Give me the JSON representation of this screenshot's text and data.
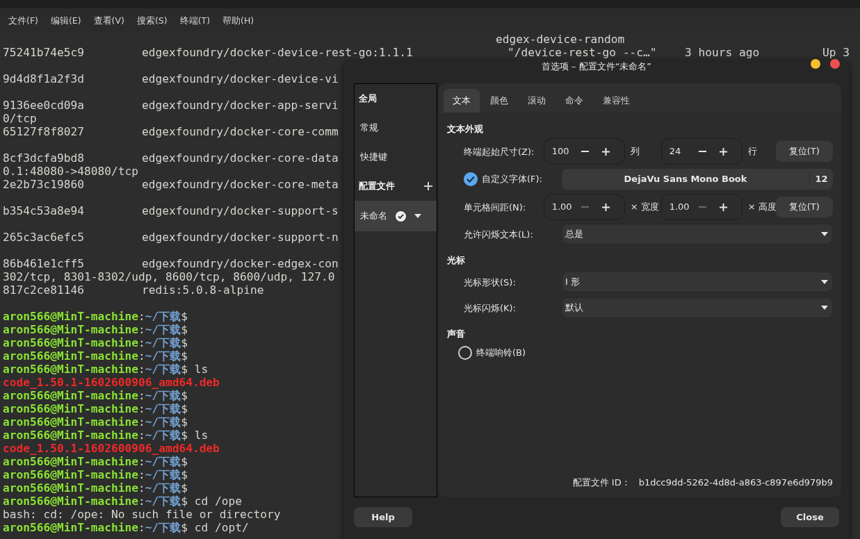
{
  "menu": [
    "文件(F)",
    "编辑(E)",
    "查看(V)",
    "搜索(S)",
    "终端(T)",
    "帮助(H)"
  ],
  "terminal": [
    {
      "kind": "name_header",
      "text": "edgex-device-random"
    },
    {
      "kind": "docker",
      "cells": [
        "75241b74e5c9",
        "edgexfoundry/docker-device-rest-go:1.1.1",
        "\"/device-rest-go --c…\"",
        "3 hours ago",
        "Up 3"
      ]
    },
    {
      "kind": "blank"
    },
    {
      "kind": "docker",
      "cells": [
        "9d4d8f1a2f3d",
        "edgexfoundry/docker-device-vi"
      ]
    },
    {
      "kind": "blank"
    },
    {
      "kind": "docker",
      "cells": [
        "9136ee0cd09a",
        "edgexfoundry/docker-app-servi"
      ]
    },
    {
      "kind": "plain",
      "text": "0/tcp"
    },
    {
      "kind": "docker",
      "cells": [
        "65127f8f8027",
        "edgexfoundry/docker-core-comm"
      ]
    },
    {
      "kind": "blank"
    },
    {
      "kind": "docker",
      "cells": [
        "8cf3dcfa9bd8",
        "edgexfoundry/docker-core-data"
      ]
    },
    {
      "kind": "plain",
      "text": "0.1:48080->48080/tcp"
    },
    {
      "kind": "docker",
      "cells": [
        "2e2b73c19860",
        "edgexfoundry/docker-core-meta"
      ]
    },
    {
      "kind": "blank"
    },
    {
      "kind": "docker",
      "cells": [
        "b354c53a8e94",
        "edgexfoundry/docker-support-s"
      ]
    },
    {
      "kind": "blank"
    },
    {
      "kind": "docker",
      "cells": [
        "265c3ac6efc5",
        "edgexfoundry/docker-support-n"
      ]
    },
    {
      "kind": "blank"
    },
    {
      "kind": "docker",
      "cells": [
        "86b461e1cff5",
        "edgexfoundry/docker-edgex-con"
      ]
    },
    {
      "kind": "plain",
      "text": "302/tcp, 8301-8302/udp, 8600/tcp, 8600/udp, 127.0"
    },
    {
      "kind": "docker",
      "cells": [
        "817c2ce81146",
        "redis:5.0.8-alpine"
      ]
    },
    {
      "kind": "blank"
    },
    {
      "kind": "prompt",
      "user": "aron566@MinT-machine",
      "separator": ":",
      "path": "~/下载",
      "sign": "$"
    },
    {
      "kind": "prompt",
      "user": "aron566@MinT-machine",
      "separator": ":",
      "path": "~/下载",
      "sign": "$"
    },
    {
      "kind": "prompt",
      "user": "aron566@MinT-machine",
      "separator": ":",
      "path": "~/下载",
      "sign": "$"
    },
    {
      "kind": "prompt",
      "user": "aron566@MinT-machine",
      "separator": ":",
      "path": "~/下载",
      "sign": "$"
    },
    {
      "kind": "prompt",
      "user": "aron566@MinT-machine",
      "separator": ":",
      "path": "~/下载",
      "sign": "$",
      "command": "ls"
    },
    {
      "kind": "file",
      "text": "code_1.50.1-1602600906_amd64.deb"
    },
    {
      "kind": "prompt",
      "user": "aron566@MinT-machine",
      "separator": ":",
      "path": "~/下载",
      "sign": "$"
    },
    {
      "kind": "prompt",
      "user": "aron566@MinT-machine",
      "separator": ":",
      "path": "~/下载",
      "sign": "$"
    },
    {
      "kind": "prompt",
      "user": "aron566@MinT-machine",
      "separator": ":",
      "path": "~/下载",
      "sign": "$"
    },
    {
      "kind": "prompt",
      "user": "aron566@MinT-machine",
      "separator": ":",
      "path": "~/下载",
      "sign": "$",
      "command": "ls"
    },
    {
      "kind": "file",
      "text": "code_1.50.1-1602600906_amd64.deb"
    },
    {
      "kind": "prompt",
      "user": "aron566@MinT-machine",
      "separator": ":",
      "path": "~/下载",
      "sign": "$"
    },
    {
      "kind": "prompt",
      "user": "aron566@MinT-machine",
      "separator": ":",
      "path": "~/下载",
      "sign": "$"
    },
    {
      "kind": "prompt",
      "user": "aron566@MinT-machine",
      "separator": ":",
      "path": "~/下载",
      "sign": "$"
    },
    {
      "kind": "prompt",
      "user": "aron566@MinT-machine",
      "separator": ":",
      "path": "~/下载",
      "sign": "$",
      "command": "cd /ope"
    },
    {
      "kind": "plain",
      "text": "bash: cd: /ope: No such file or directory"
    },
    {
      "kind": "prompt",
      "user": "aron566@MinT-machine",
      "separator": ":",
      "path": "~/下载",
      "sign": "$",
      "command": "cd /opt/"
    }
  ],
  "dialog": {
    "title": "首选项 – 配置文件“未命名”",
    "sidebar": [
      {
        "kind": "header",
        "label": "全局"
      },
      {
        "kind": "item",
        "label": "常规",
        "selected": false
      },
      {
        "kind": "item",
        "label": "快捷键",
        "selected": false
      },
      {
        "kind": "header",
        "label": "配置文件",
        "add": true
      },
      {
        "kind": "profile",
        "label": "未命名",
        "selected": true,
        "default": true
      }
    ],
    "tabs": [
      {
        "label": "文本",
        "selected": true
      },
      {
        "label": "颜色",
        "selected": false
      },
      {
        "label": "滚动",
        "selected": false
      },
      {
        "label": "命令",
        "selected": false
      },
      {
        "label": "兼容性",
        "selected": false
      }
    ],
    "sections": [
      {
        "title": "文本外观",
        "rows": [
          {
            "kind": "spins",
            "label": "终端起始尺寸(Z):",
            "spins": [
              {
                "value": "100",
                "unit": "列",
                "decrement_disabled": false
              },
              {
                "value": "24",
                "unit": "行",
                "decrement_disabled": false
              }
            ],
            "button": "复位(T)"
          },
          {
            "kind": "font",
            "label": "自定义字体(F):",
            "checked": true,
            "font": "DejaVu Sans Mono Book",
            "size": "12"
          },
          {
            "kind": "spins",
            "label": "单元格间距(N):",
            "spins": [
              {
                "value": "1.00",
                "unit": "× 宽度",
                "decrement_disabled": true
              },
              {
                "value": "1.00",
                "unit": "× 高度",
                "decrement_disabled": true
              }
            ],
            "button": "复位(T)"
          },
          {
            "kind": "select",
            "label": "允许闪烁文本(L):",
            "value": "总是"
          }
        ]
      },
      {
        "title": "光标",
        "rows": [
          {
            "kind": "select",
            "label": "光标形状(S):",
            "value": "I 形"
          },
          {
            "kind": "select",
            "label": "光标闪烁(K):",
            "value": "默认"
          }
        ]
      },
      {
        "title": "声音",
        "rows": [
          {
            "kind": "radio",
            "label": "终端响铃(B)",
            "checked": false
          }
        ]
      }
    ],
    "profile_id_label": "配置文件 ID：",
    "profile_id": "b1dcc9dd-5262-4d8d-a863-c897e6d979b9",
    "buttons": [
      "Help",
      "Close"
    ]
  }
}
